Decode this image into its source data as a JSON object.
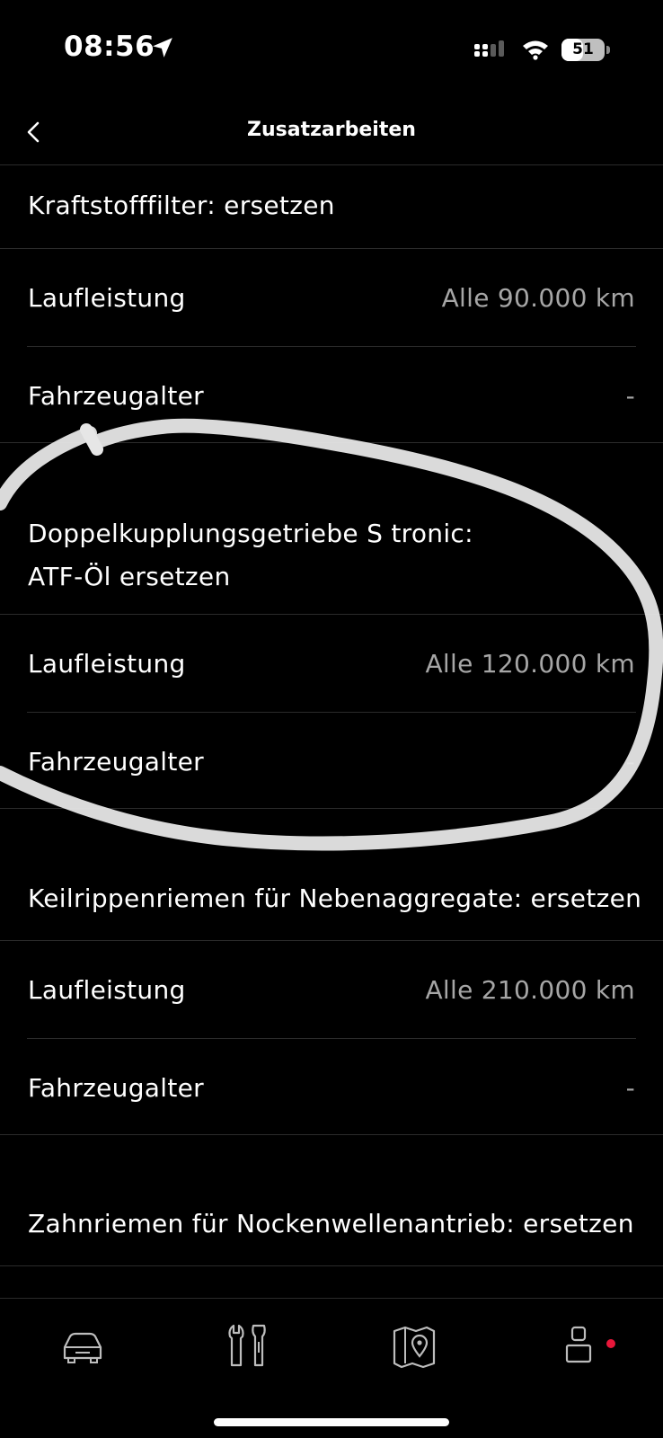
{
  "status_bar": {
    "time": "08:56",
    "battery_level": "51",
    "icons": [
      "location-arrow-icon",
      "cellular-signal-icon",
      "wifi-icon",
      "battery-icon"
    ]
  },
  "nav": {
    "back_icon": "chevron-left-icon",
    "title": "Zusatzarbeiten"
  },
  "sections": [
    {
      "heading": "Kraftstofffilter: ersetzen",
      "rows": [
        {
          "label": "Laufleistung",
          "value": "Alle 90.000 km"
        },
        {
          "label": "Fahrzeugalter",
          "value": "-"
        }
      ]
    },
    {
      "heading": "Doppelkupplungsgetriebe S tronic: ATF-Öl ersetzen",
      "rows": [
        {
          "label": "Laufleistung",
          "value": "Alle 120.000 km"
        },
        {
          "label": "Fahrzeugalter",
          "value": "-"
        }
      ]
    },
    {
      "heading": "Keilrippenriemen für Nebenaggregate: ersetzen",
      "rows": [
        {
          "label": "Laufleistung",
          "value": "Alle 210.000 km"
        },
        {
          "label": "Fahrzeugalter",
          "value": "-"
        }
      ]
    },
    {
      "heading": "Zahnriemen für Nockenwellenantrieb: ersetzen",
      "rows": []
    }
  ],
  "tab_bar": {
    "tabs": [
      {
        "icon": "car-icon"
      },
      {
        "icon": "service-tools-icon"
      },
      {
        "icon": "map-pin-icon"
      },
      {
        "icon": "profile-icon",
        "notification": true
      }
    ],
    "badge_color": "#e8173a"
  },
  "annotation": {
    "type": "hand-drawn circle",
    "color": "#ffffff"
  }
}
